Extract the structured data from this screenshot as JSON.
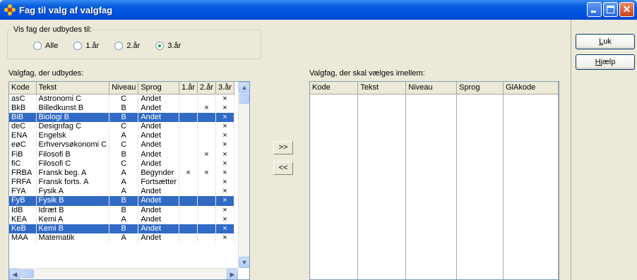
{
  "window": {
    "title": "Fag til valg af valgfag",
    "colors": {
      "titlebar": "#0054e3",
      "selection": "#316ac5",
      "background": "#ece9d8"
    }
  },
  "filter": {
    "group_label": "Vis fag der udbydes til:",
    "options": [
      {
        "label": "Alle",
        "checked": false
      },
      {
        "label": "1.år",
        "checked": false
      },
      {
        "label": "2.år",
        "checked": false
      },
      {
        "label": "3.år",
        "checked": true
      }
    ]
  },
  "offered": {
    "label": "Valgfag, der udbydes:",
    "columns": [
      "Kode",
      "Tekst",
      "Niveau",
      "Sprog",
      "1.år",
      "2.år",
      "3.år"
    ],
    "rows": [
      {
        "kode": "asC",
        "tekst": "Astronomi C",
        "niveau": "C",
        "sprog": "Andet",
        "y1": "",
        "y2": "",
        "y3": "×",
        "selected": false
      },
      {
        "kode": "BkB",
        "tekst": "Billedkunst B",
        "niveau": "B",
        "sprog": "Andet",
        "y1": "",
        "y2": "×",
        "y3": "×",
        "selected": false
      },
      {
        "kode": "BiB",
        "tekst": "Biologi B",
        "niveau": "B",
        "sprog": "Andet",
        "y1": "",
        "y2": "",
        "y3": "×",
        "selected": true
      },
      {
        "kode": "deC",
        "tekst": "Designfag C",
        "niveau": "C",
        "sprog": "Andet",
        "y1": "",
        "y2": "",
        "y3": "×",
        "selected": false
      },
      {
        "kode": "ENA",
        "tekst": "Engelsk",
        "niveau": "A",
        "sprog": "Andet",
        "y1": "",
        "y2": "",
        "y3": "×",
        "selected": false
      },
      {
        "kode": "eøC",
        "tekst": "Erhvervsøkonomi C",
        "niveau": "C",
        "sprog": "Andet",
        "y1": "",
        "y2": "",
        "y3": "×",
        "selected": false
      },
      {
        "kode": "FiB",
        "tekst": "Filosofi B",
        "niveau": "B",
        "sprog": "Andet",
        "y1": "",
        "y2": "×",
        "y3": "×",
        "selected": false
      },
      {
        "kode": "fiC",
        "tekst": "Filosofi C",
        "niveau": "C",
        "sprog": "Andet",
        "y1": "",
        "y2": "",
        "y3": "×",
        "selected": false
      },
      {
        "kode": "FRBA",
        "tekst": "Fransk beg. A",
        "niveau": "A",
        "sprog": "Begynder",
        "y1": "×",
        "y2": "×",
        "y3": "×",
        "selected": false
      },
      {
        "kode": "FRFA",
        "tekst": "Fransk forts. A",
        "niveau": "A",
        "sprog": "Fortsætter",
        "y1": "",
        "y2": "",
        "y3": "×",
        "selected": false
      },
      {
        "kode": "FYA",
        "tekst": "Fysik A",
        "niveau": "A",
        "sprog": "Andet",
        "y1": "",
        "y2": "",
        "y3": "×",
        "selected": false
      },
      {
        "kode": "FyB",
        "tekst": "Fysik B",
        "niveau": "B",
        "sprog": "Andet",
        "y1": "",
        "y2": "",
        "y3": "×",
        "selected": true
      },
      {
        "kode": "IdB",
        "tekst": "Idræt B",
        "niveau": "B",
        "sprog": "Andet",
        "y1": "",
        "y2": "",
        "y3": "×",
        "selected": false
      },
      {
        "kode": "KEA",
        "tekst": "Kemi A",
        "niveau": "A",
        "sprog": "Andet",
        "y1": "",
        "y2": "",
        "y3": "×",
        "selected": false
      },
      {
        "kode": "KeB",
        "tekst": "Kemi B",
        "niveau": "B",
        "sprog": "Andet",
        "y1": "",
        "y2": "",
        "y3": "×",
        "selected": true
      },
      {
        "kode": "MAA",
        "tekst": "Matematik",
        "niveau": "A",
        "sprog": "Andet",
        "y1": "",
        "y2": "",
        "y3": "×",
        "selected": false
      }
    ]
  },
  "transfer": {
    "add_label": ">>",
    "remove_label": "<<"
  },
  "chosen": {
    "label": "Valgfag, der skal vælges imellem:",
    "columns": [
      "Kode",
      "Tekst",
      "Niveau",
      "Sprog",
      "GlAkode"
    ]
  },
  "actions": {
    "close_pre": "",
    "close_key": "L",
    "close_post": "uk",
    "help_pre": "",
    "help_key": "H",
    "help_post": "jælp"
  },
  "scroll": {
    "up": "▲",
    "down": "▼",
    "left": "◀",
    "right": "▶"
  }
}
